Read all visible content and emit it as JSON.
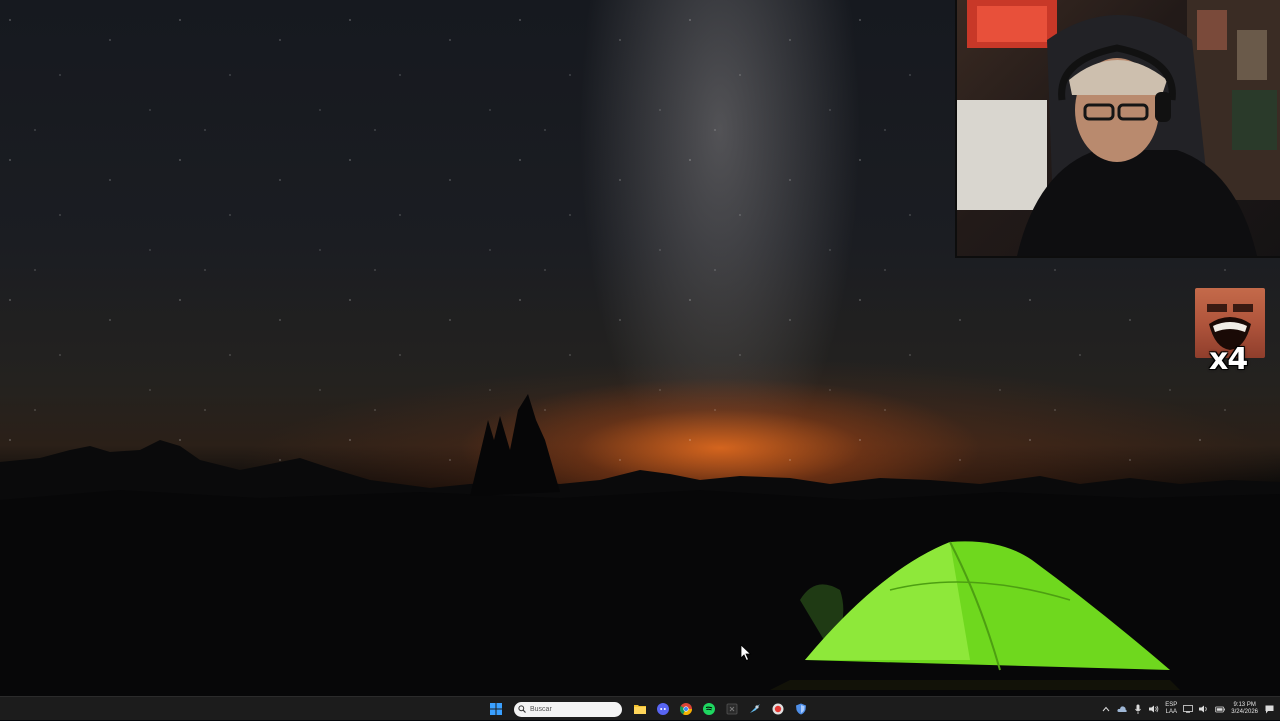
{
  "desktop": {
    "wallpaper": "night-sky-camping-tent",
    "colors": {
      "sky": "#1b1d22",
      "horizon_glow": "#eb6e1e",
      "tent": "#6fd81e"
    }
  },
  "overlay": {
    "emote": {
      "icon": "laughing-face-emote",
      "count_label": "x4"
    }
  },
  "taskbar": {
    "start_icon": "windows-start-icon",
    "search": {
      "placeholder": "Buscar",
      "icon": "search-icon"
    },
    "apps": [
      {
        "name": "file-explorer",
        "icon": "folder-icon"
      },
      {
        "name": "discord",
        "icon": "discord-icon"
      },
      {
        "name": "chrome",
        "icon": "chrome-icon"
      },
      {
        "name": "spotify",
        "icon": "spotify-icon"
      },
      {
        "name": "excel",
        "icon": "excel-icon"
      },
      {
        "name": "steam",
        "icon": "steam-icon"
      },
      {
        "name": "recorder",
        "icon": "record-icon"
      },
      {
        "name": "shield-app",
        "icon": "shield-icon"
      }
    ],
    "tray": {
      "lang_top": "ESP",
      "lang_bottom": "LAA",
      "time": "9:13 PM",
      "date": "3/24/2026"
    }
  }
}
